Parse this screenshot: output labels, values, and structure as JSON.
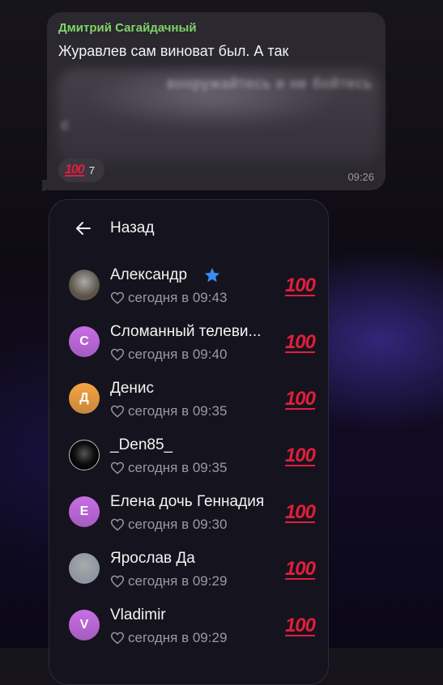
{
  "message": {
    "sender": "Дмитрий Сагайдачный",
    "line1": "Журавлев сам виноват был. А так",
    "blurred_line2": "вооружайтесь и не бойтесь",
    "blurred_line3": "с",
    "reaction_emoji": "💯",
    "reaction_count": "7",
    "time": "09:26"
  },
  "panel": {
    "back_label": "Назад",
    "rows": [
      {
        "name": "Александр",
        "time": "сегодня в 09:43",
        "avatar_letter": "",
        "avatar_color": "#5b5348",
        "badge": "star-icon"
      },
      {
        "name": "Сломанный телеви...",
        "time": "сегодня в 09:40",
        "avatar_letter": "С",
        "avatar_color": "#c86ee6"
      },
      {
        "name": "Денис",
        "time": "сегодня в 09:35",
        "avatar_letter": "Д",
        "avatar_color": "#f5a442"
      },
      {
        "name": "_Den85_",
        "time": "сегодня в 09:35",
        "avatar_letter": "",
        "avatar_color": "#0a0a0a"
      },
      {
        "name": "Елена дочь Геннадия",
        "time": "сегодня в 09:30",
        "avatar_letter": "Е",
        "avatar_color": "#c86ee6"
      },
      {
        "name": "Ярослав Да",
        "time": "сегодня в 09:29",
        "avatar_letter": "",
        "avatar_color": "#8f97a3"
      },
      {
        "name": "Vladimir",
        "time": "сегодня в 09:29",
        "avatar_letter": "V",
        "avatar_color": "#c86ee6"
      }
    ],
    "row_reaction": "💯"
  },
  "colors": {
    "accent_name": "#7fd466",
    "reaction_red": "#e01e3c",
    "star_blue": "#3d8bf2"
  }
}
